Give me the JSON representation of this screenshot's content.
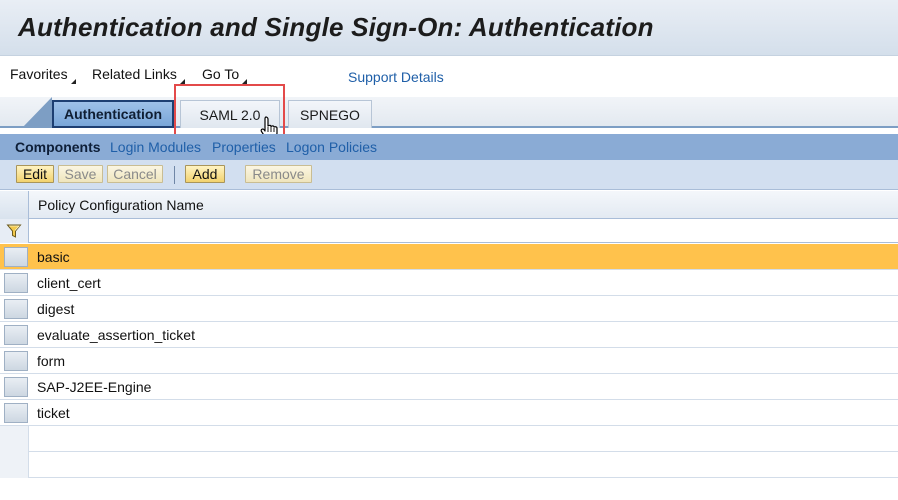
{
  "page": {
    "title": "Authentication and Single Sign-On: Authentication"
  },
  "menu": {
    "items": [
      {
        "label": "Favorites",
        "icon": "menu-triangle-icon"
      },
      {
        "label": "Related Links",
        "icon": "menu-triangle-icon"
      },
      {
        "label": "Go To",
        "icon": "menu-triangle-icon"
      }
    ],
    "support_link": "Support Details"
  },
  "tabs": [
    {
      "label": "Authentication",
      "active": true
    },
    {
      "label": "SAML 2.0",
      "active": false
    },
    {
      "label": "SPNEGO",
      "active": false
    }
  ],
  "sub_nav": {
    "items": [
      {
        "label": "Components",
        "active": true
      },
      {
        "label": "Login Modules",
        "active": false
      },
      {
        "label": "Properties",
        "active": false
      },
      {
        "label": "Logon Policies",
        "active": false
      }
    ]
  },
  "toolbar": {
    "buttons": [
      {
        "label": "Edit",
        "enabled": true
      },
      {
        "label": "Save",
        "enabled": false
      },
      {
        "label": "Cancel",
        "enabled": false
      },
      {
        "label": "Add",
        "enabled": true
      },
      {
        "label": "Remove",
        "enabled": false
      }
    ]
  },
  "table": {
    "columns": [
      "Policy Configuration Name"
    ],
    "filter_icon": "filter-funnel-icon",
    "rows": [
      "basic",
      "client_cert",
      "digest",
      "evaluate_assertion_ticket",
      "form",
      "SAP-J2EE-Engine",
      "ticket"
    ],
    "selected_index": 0
  },
  "colors": {
    "accent_blue": "#8aabd5",
    "selected_row": "#ffc24c",
    "link": "#1f5fa8",
    "highlight_box": "#e34a4a"
  },
  "cursor": {
    "icon": "hand-pointer-icon"
  }
}
